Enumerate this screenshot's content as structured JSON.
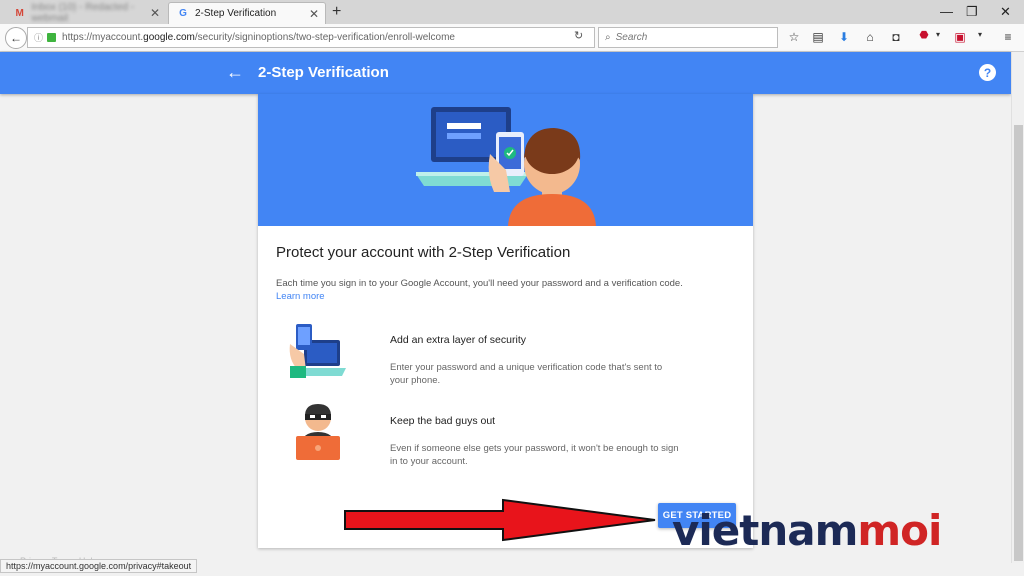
{
  "browser": {
    "tabs": [
      {
        "label": "Inbox (10) - Redacted - webmail",
        "active": false,
        "favicon": "gmail-icon"
      },
      {
        "label": "2-Step Verification",
        "active": true,
        "favicon": "google-g-icon"
      }
    ],
    "url_prefix": "https://myaccount.",
    "url_domain": "google.com",
    "url_path": "/security/signinoptions/two-step-verification/enroll-welcome",
    "search_placeholder": "Search",
    "status_link": "https://myaccount.google.com/privacy#takeout"
  },
  "app": {
    "title": "2-Step Verification",
    "help_label": "?",
    "accent_color": "#4285f4"
  },
  "card": {
    "title": "Protect your account with 2-Step Verification",
    "description": "Each time you sign in to your Google Account, you'll need your password and a verification code.",
    "learn_more": "Learn more",
    "features": [
      {
        "title": "Add an extra layer of security",
        "description": "Enter your password and a unique verification code that's sent to your phone."
      },
      {
        "title": "Keep the bad guys out",
        "description": "Even if someone else gets your password, it won't be enough to sign in to your account."
      }
    ],
    "cta": "GET STARTED"
  },
  "footer": {
    "links": "Privacy  Terms  Help"
  },
  "watermark": {
    "part1": "vietnam",
    "part2": "moi"
  }
}
